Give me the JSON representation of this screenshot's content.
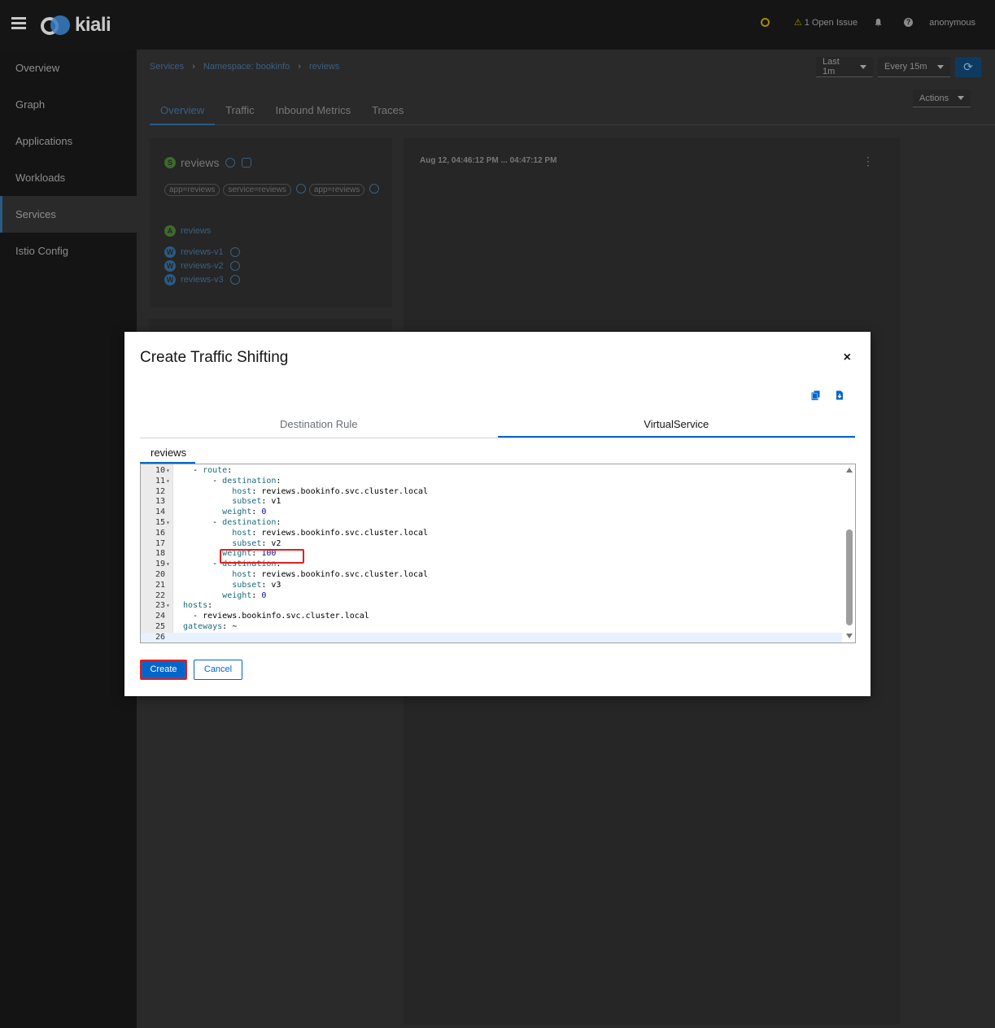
{
  "masthead": {
    "brand": "kiali",
    "issues_label": "1 Open Issue",
    "user": "anonymous"
  },
  "sidebar": {
    "items": [
      {
        "label": "Overview"
      },
      {
        "label": "Graph"
      },
      {
        "label": "Applications"
      },
      {
        "label": "Workloads"
      },
      {
        "label": "Services"
      },
      {
        "label": "Istio Config"
      }
    ]
  },
  "breadcrumb": {
    "services": "Services",
    "namespace": "Namespace: bookinfo",
    "current": "reviews"
  },
  "time_controls": {
    "duration": "Last 1m",
    "refresh": "Every 15m"
  },
  "actions_label": "Actions",
  "page_tabs": [
    {
      "label": "Overview"
    },
    {
      "label": "Traffic"
    },
    {
      "label": "Inbound Metrics"
    },
    {
      "label": "Traces"
    }
  ],
  "service_card": {
    "badge": "S",
    "name": "reviews",
    "labels": [
      "app=reviews",
      "service=reviews",
      "app=reviews"
    ],
    "app_badge": "A",
    "app": "reviews",
    "workload_badge": "W",
    "workloads": [
      "reviews-v1",
      "reviews-v2",
      "reviews-v3"
    ]
  },
  "graph_card": {
    "date_range": "Aug 12, 04:46:12 PM ... 04:47:12 PM"
  },
  "modal": {
    "title": "Create Traffic Shifting",
    "close": "×",
    "tabs": [
      {
        "label": "Destination Rule"
      },
      {
        "label": "VirtualService"
      }
    ],
    "subtab": "reviews",
    "create_label": "Create",
    "cancel_label": "Cancel"
  },
  "editor": {
    "lines": [
      {
        "n": "10",
        "fold": "▾",
        "indent": "  ",
        "dash": "- ",
        "key": "route",
        "sep": ":",
        "val": ""
      },
      {
        "n": "11",
        "fold": "▾",
        "indent": "      ",
        "dash": "- ",
        "key": "destination",
        "sep": ":",
        "val": ""
      },
      {
        "n": "12",
        "fold": "",
        "indent": "          ",
        "dash": "",
        "key": "host",
        "sep": ": ",
        "val": "reviews.bookinfo.svc.cluster.local"
      },
      {
        "n": "13",
        "fold": "",
        "indent": "          ",
        "dash": "",
        "key": "subset",
        "sep": ": ",
        "val": "v1"
      },
      {
        "n": "14",
        "fold": "",
        "indent": "        ",
        "dash": "",
        "key": "weight",
        "sep": ": ",
        "num": "0"
      },
      {
        "n": "15",
        "fold": "▾",
        "indent": "      ",
        "dash": "- ",
        "key": "destination",
        "sep": ":",
        "val": ""
      },
      {
        "n": "16",
        "fold": "",
        "indent": "          ",
        "dash": "",
        "key": "host",
        "sep": ": ",
        "val": "reviews.bookinfo.svc.cluster.local"
      },
      {
        "n": "17",
        "fold": "",
        "indent": "          ",
        "dash": "",
        "key": "subset",
        "sep": ": ",
        "val": "v2"
      },
      {
        "n": "18",
        "fold": "",
        "indent": "        ",
        "dash": "",
        "key": "weight",
        "sep": ": ",
        "num": "100"
      },
      {
        "n": "19",
        "fold": "▾",
        "indent": "      ",
        "dash": "- ",
        "key": "destination",
        "sep": ":",
        "val": ""
      },
      {
        "n": "20",
        "fold": "",
        "indent": "          ",
        "dash": "",
        "key": "host",
        "sep": ": ",
        "val": "reviews.bookinfo.svc.cluster.local"
      },
      {
        "n": "21",
        "fold": "",
        "indent": "          ",
        "dash": "",
        "key": "subset",
        "sep": ": ",
        "val": "v3"
      },
      {
        "n": "22",
        "fold": "",
        "indent": "        ",
        "dash": "",
        "key": "weight",
        "sep": ": ",
        "num": "0"
      },
      {
        "n": "23",
        "fold": "▾",
        "indent": "",
        "dash": "",
        "key": "hosts",
        "sep": ":",
        "val": ""
      },
      {
        "n": "24",
        "fold": "",
        "indent": "  ",
        "dash": "- ",
        "key": "",
        "sep": "",
        "val": "reviews.bookinfo.svc.cluster.local"
      },
      {
        "n": "25",
        "fold": "",
        "indent": "",
        "dash": "",
        "key": "gateways",
        "sep": ": ",
        "val": "~"
      },
      {
        "n": "26",
        "fold": "",
        "indent": "",
        "dash": "",
        "key": "",
        "sep": "",
        "val": "",
        "cursor": true
      }
    ]
  },
  "colors": {
    "accent": "#0066cc",
    "highlight": "#e02020",
    "masthead": "#151515",
    "sidebar": "#141414"
  }
}
